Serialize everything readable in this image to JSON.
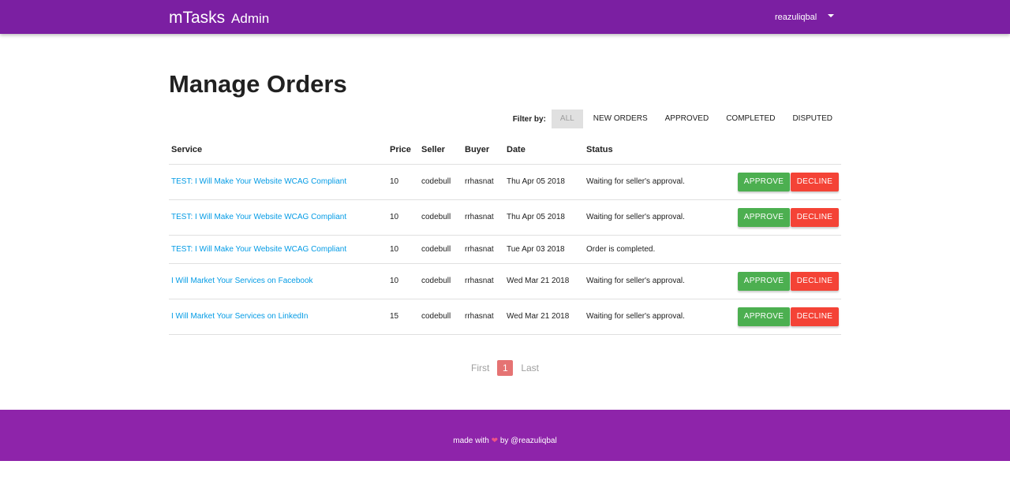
{
  "navbar": {
    "brand": "mTasks",
    "brand_sub": "Admin",
    "user": "reazuliqbal"
  },
  "page": {
    "title": "Manage Orders"
  },
  "filter": {
    "label": "Filter by:",
    "options": [
      "ALL",
      "NEW ORDERS",
      "APPROVED",
      "COMPLETED",
      "DISPUTED"
    ],
    "selected": "ALL"
  },
  "table": {
    "columns": [
      "Service",
      "Price",
      "Seller",
      "Buyer",
      "Date",
      "Status"
    ],
    "rows": [
      {
        "service": "TEST: I Will Make Your Website WCAG Compliant",
        "price": "10",
        "seller": "codebull",
        "buyer": "rrhasnat",
        "date": "Thu Apr 05 2018",
        "status": "Waiting for seller's approval.",
        "approve": "APPROVE",
        "decline": "DECLINE"
      },
      {
        "service": "TEST: I Will Make Your Website WCAG Compliant",
        "price": "10",
        "seller": "codebull",
        "buyer": "rrhasnat",
        "date": "Thu Apr 05 2018",
        "status": "Waiting for seller's approval.",
        "approve": "APPROVE",
        "decline": "DECLINE"
      },
      {
        "service": "TEST: I Will Make Your Website WCAG Compliant",
        "price": "10",
        "seller": "codebull",
        "buyer": "rrhasnat",
        "date": "Tue Apr 03 2018",
        "status": "Order is completed."
      },
      {
        "service": "I Will Market Your Services on Facebook",
        "price": "10",
        "seller": "codebull",
        "buyer": "rrhasnat",
        "date": "Wed Mar 21 2018",
        "status": "Waiting for seller's approval.",
        "approve": "APPROVE",
        "decline": "DECLINE"
      },
      {
        "service": "I Will Market Your Services on LinkedIn",
        "price": "15",
        "seller": "codebull",
        "buyer": "rrhasnat",
        "date": "Wed Mar 21 2018",
        "status": "Waiting for seller's approval.",
        "approve": "APPROVE",
        "decline": "DECLINE"
      }
    ]
  },
  "pagination": {
    "first": "First",
    "current": "1",
    "last": "Last"
  },
  "footer": {
    "text_before": "made with",
    "heart": "❤",
    "text_after": "by @reazuliqbal"
  },
  "colors": {
    "navbar": "#7b1fa2",
    "footer": "#8e24aa",
    "approve": "#4caf50",
    "decline": "#f44336",
    "link": "#039be5",
    "page_current": "#e57373"
  }
}
